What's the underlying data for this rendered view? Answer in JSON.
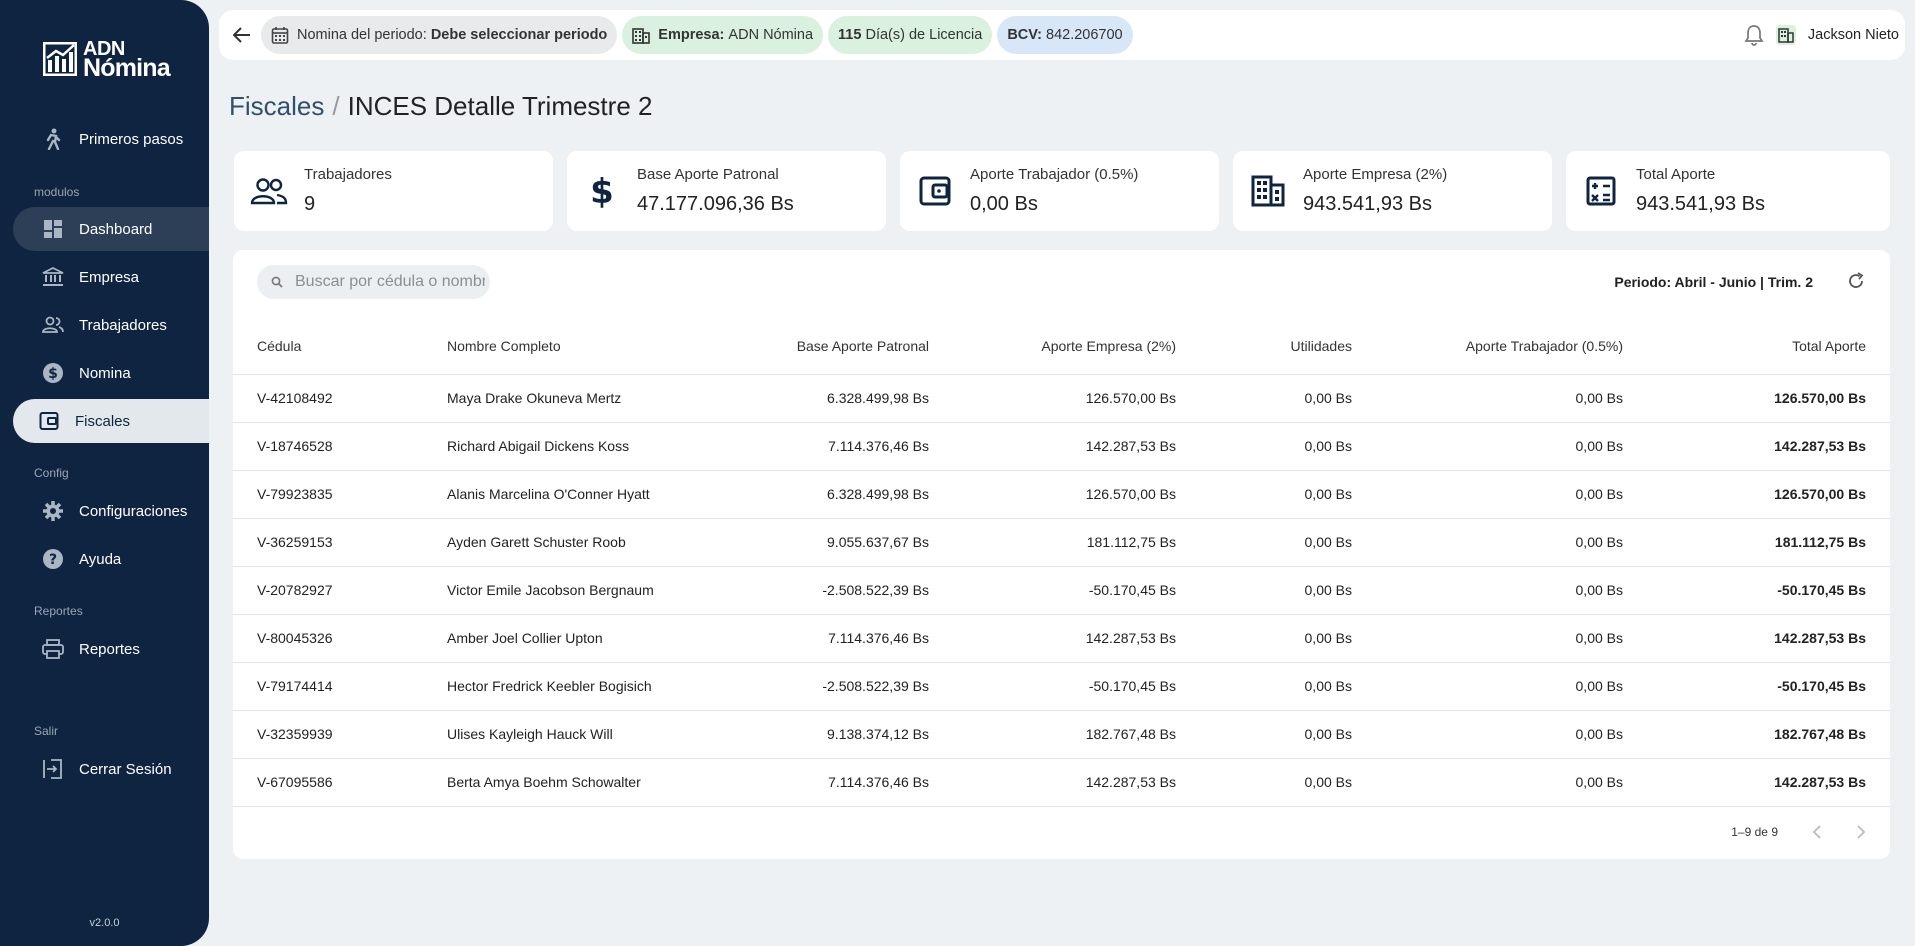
{
  "sidebar": {
    "logo": {
      "line1": "ADN",
      "line2": "Nómina"
    },
    "sections": {
      "modulos": "modulos",
      "config": "Config",
      "reportes": "Reportes",
      "salir": "Salir"
    },
    "items": {
      "primeros_pasos": "Primeros pasos",
      "dashboard": "Dashboard",
      "empresa": "Empresa",
      "trabajadores": "Trabajadores",
      "nomina": "Nomina",
      "fiscales": "Fiscales",
      "configuraciones": "Configuraciones",
      "ayuda": "Ayuda",
      "reportes": "Reportes",
      "cerrar_sesion": "Cerrar Sesión"
    },
    "version": "v2.0.0"
  },
  "topbar": {
    "periodo_label": "Nomina del periodo:",
    "periodo_value": "Debe seleccionar periodo",
    "empresa_label": "Empresa:",
    "empresa_value": "ADN Nómina",
    "licencia_count": "115",
    "licencia_label": "Día(s) de Licencia",
    "bcv_label": "BCV:",
    "bcv_value": "842.206700",
    "user": "Jackson Nieto"
  },
  "page": {
    "breadcrumb": "Fiscales",
    "title": "INCES Detalle Trimestre 2"
  },
  "stats": {
    "trabajadores": {
      "label": "Trabajadores",
      "value": "9"
    },
    "base": {
      "label": "Base Aporte Patronal",
      "value": "47.177.096,36 Bs"
    },
    "aporte_trabajador": {
      "label": "Aporte Trabajador (0.5%)",
      "value": "0,00 Bs"
    },
    "aporte_empresa": {
      "label": "Aporte Empresa (2%)",
      "value": "943.541,93 Bs"
    },
    "total": {
      "label": "Total Aporte",
      "value": "943.541,93 Bs"
    }
  },
  "search": {
    "placeholder": "Buscar por cédula o nombre..."
  },
  "period": "Periodo: Abril - Junio | Trim. 2",
  "table": {
    "headers": [
      "Cédula",
      "Nombre Completo",
      "Base Aporte Patronal",
      "Aporte Empresa (2%)",
      "Utilidades",
      "Aporte Trabajador (0.5%)",
      "Total Aporte"
    ],
    "rows": [
      [
        "V-42108492",
        "Maya Drake Okuneva Mertz",
        "6.328.499,98 Bs",
        "126.570,00 Bs",
        "0,00 Bs",
        "0,00 Bs",
        "126.570,00 Bs"
      ],
      [
        "V-18746528",
        "Richard Abigail Dickens Koss",
        "7.114.376,46 Bs",
        "142.287,53 Bs",
        "0,00 Bs",
        "0,00 Bs",
        "142.287,53 Bs"
      ],
      [
        "V-79923835",
        "Alanis Marcelina O'Conner Hyatt",
        "6.328.499,98 Bs",
        "126.570,00 Bs",
        "0,00 Bs",
        "0,00 Bs",
        "126.570,00 Bs"
      ],
      [
        "V-36259153",
        "Ayden Garett Schuster Roob",
        "9.055.637,67 Bs",
        "181.112,75 Bs",
        "0,00 Bs",
        "0,00 Bs",
        "181.112,75 Bs"
      ],
      [
        "V-20782927",
        "Victor Emile Jacobson Bergnaum",
        "-2.508.522,39 Bs",
        "-50.170,45 Bs",
        "0,00 Bs",
        "0,00 Bs",
        "-50.170,45 Bs"
      ],
      [
        "V-80045326",
        "Amber Joel Collier Upton",
        "7.114.376,46 Bs",
        "142.287,53 Bs",
        "0,00 Bs",
        "0,00 Bs",
        "142.287,53 Bs"
      ],
      [
        "V-79174414",
        "Hector Fredrick Keebler Bogisich",
        "-2.508.522,39 Bs",
        "-50.170,45 Bs",
        "0,00 Bs",
        "0,00 Bs",
        "-50.170,45 Bs"
      ],
      [
        "V-32359939",
        "Ulises Kayleigh Hauck Will",
        "9.138.374,12 Bs",
        "182.767,48 Bs",
        "0,00 Bs",
        "0,00 Bs",
        "182.767,48 Bs"
      ],
      [
        "V-67095586",
        "Berta Amya Boehm Schowalter",
        "7.114.376,46 Bs",
        "142.287,53 Bs",
        "0,00 Bs",
        "0,00 Bs",
        "142.287,53 Bs"
      ]
    ]
  },
  "pagination": {
    "label": "1–9 de 9"
  },
  "colors": {
    "sidebar": "#0e2440",
    "chip_green": "#d9f1de",
    "chip_blue": "#d8e7f8",
    "chip_grey": "#e8eaec"
  }
}
